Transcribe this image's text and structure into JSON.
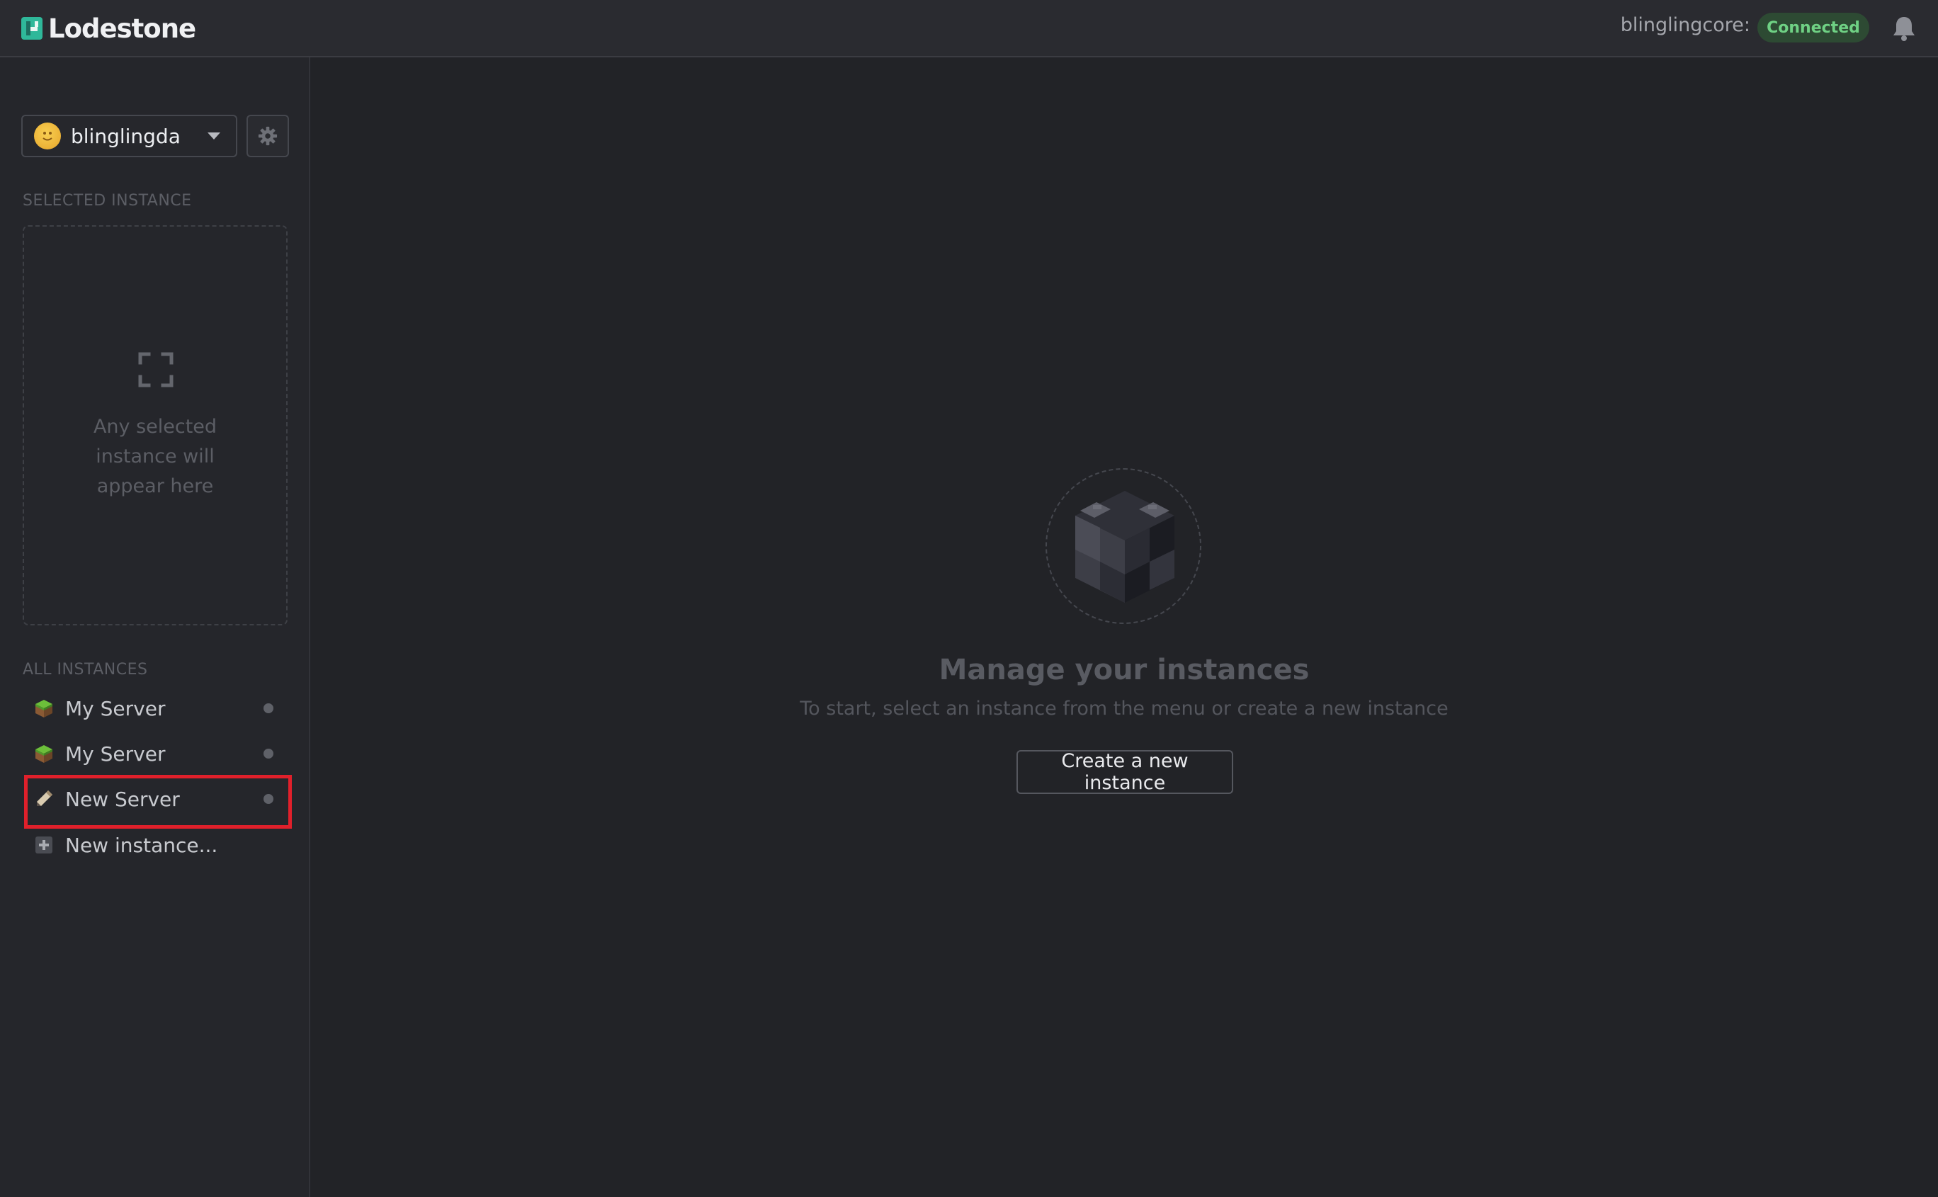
{
  "header": {
    "app_name": "Lodestone",
    "core_name": "blinglingcore:",
    "connection_status": "Connected",
    "status_color": "#6fd184",
    "bell_icon": "bell-icon"
  },
  "sidebar": {
    "user": {
      "name": "blinglingda"
    },
    "settings_icon": "gear-icon",
    "selected_section_label": "SELECTED INSTANCE",
    "selected_placeholder": [
      "Any selected",
      "instance will",
      "appear here"
    ],
    "all_section_label": "ALL INSTANCES",
    "instances": [
      {
        "label": "My Server",
        "icon": "grass-block-icon"
      },
      {
        "label": "My Server",
        "icon": "grass-block-icon"
      },
      {
        "label": "New Server",
        "icon": "pencil-icon"
      }
    ],
    "new_instance_label": "New instance..."
  },
  "main": {
    "title": "Manage your instances",
    "subtitle": "To start, select an instance from the menu or create a new instance",
    "create_button": "Create a new instance"
  },
  "colors": {
    "background": "#222327",
    "highlight": "#e0202b",
    "accent": "#2fb89a"
  }
}
